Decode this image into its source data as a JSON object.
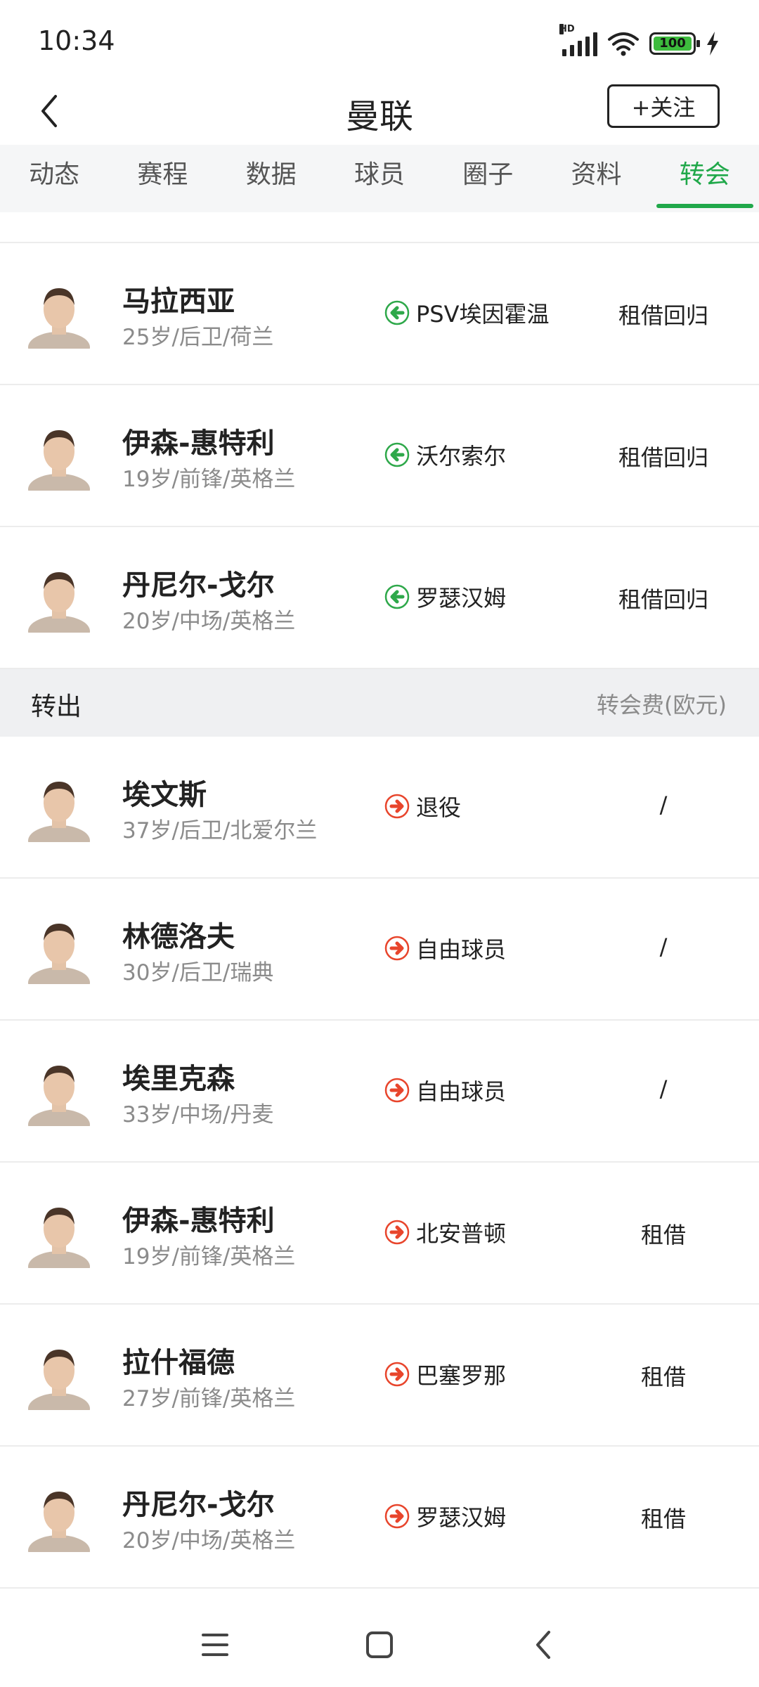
{
  "status": {
    "time": "10:34",
    "battery": "100",
    "hd": "HD"
  },
  "header": {
    "title": "曼联",
    "follow_label": "+关注"
  },
  "tabs": [
    {
      "label": "动态"
    },
    {
      "label": "赛程"
    },
    {
      "label": "数据"
    },
    {
      "label": "球员"
    },
    {
      "label": "圈子"
    },
    {
      "label": "资料"
    },
    {
      "label": "转会",
      "active": true
    }
  ],
  "transfers_in": [
    {
      "name": "马拉西亚",
      "meta": "25岁/后卫/荷兰",
      "club": "PSV埃因霍温",
      "fee": "租借回归"
    },
    {
      "name": "伊森-惠特利",
      "meta": "19岁/前锋/英格兰",
      "club": "沃尔索尔",
      "fee": "租借回归"
    },
    {
      "name": "丹尼尔-戈尔",
      "meta": "20岁/中场/英格兰",
      "club": "罗瑟汉姆",
      "fee": "租借回归"
    }
  ],
  "out_section": {
    "label": "转出",
    "fee_header": "转会费(欧元)"
  },
  "transfers_out": [
    {
      "name": "埃文斯",
      "meta": "37岁/后卫/北爱尔兰",
      "club": "退役",
      "fee": "/"
    },
    {
      "name": "林德洛夫",
      "meta": "30岁/后卫/瑞典",
      "club": "自由球员",
      "fee": "/"
    },
    {
      "name": "埃里克森",
      "meta": "33岁/中场/丹麦",
      "club": "自由球员",
      "fee": "/"
    },
    {
      "name": "伊森-惠特利",
      "meta": "19岁/前锋/英格兰",
      "club": "北安普顿",
      "fee": "租借"
    },
    {
      "name": "拉什福德",
      "meta": "27岁/前锋/英格兰",
      "club": "巴塞罗那",
      "fee": "租借"
    },
    {
      "name": "丹尼尔-戈尔",
      "meta": "20岁/中场/英格兰",
      "club": "罗瑟汉姆",
      "fee": "租借"
    }
  ],
  "colors": {
    "accent": "#20a84a",
    "in_arrow": "#2ea84a",
    "out_arrow": "#e8452c"
  }
}
